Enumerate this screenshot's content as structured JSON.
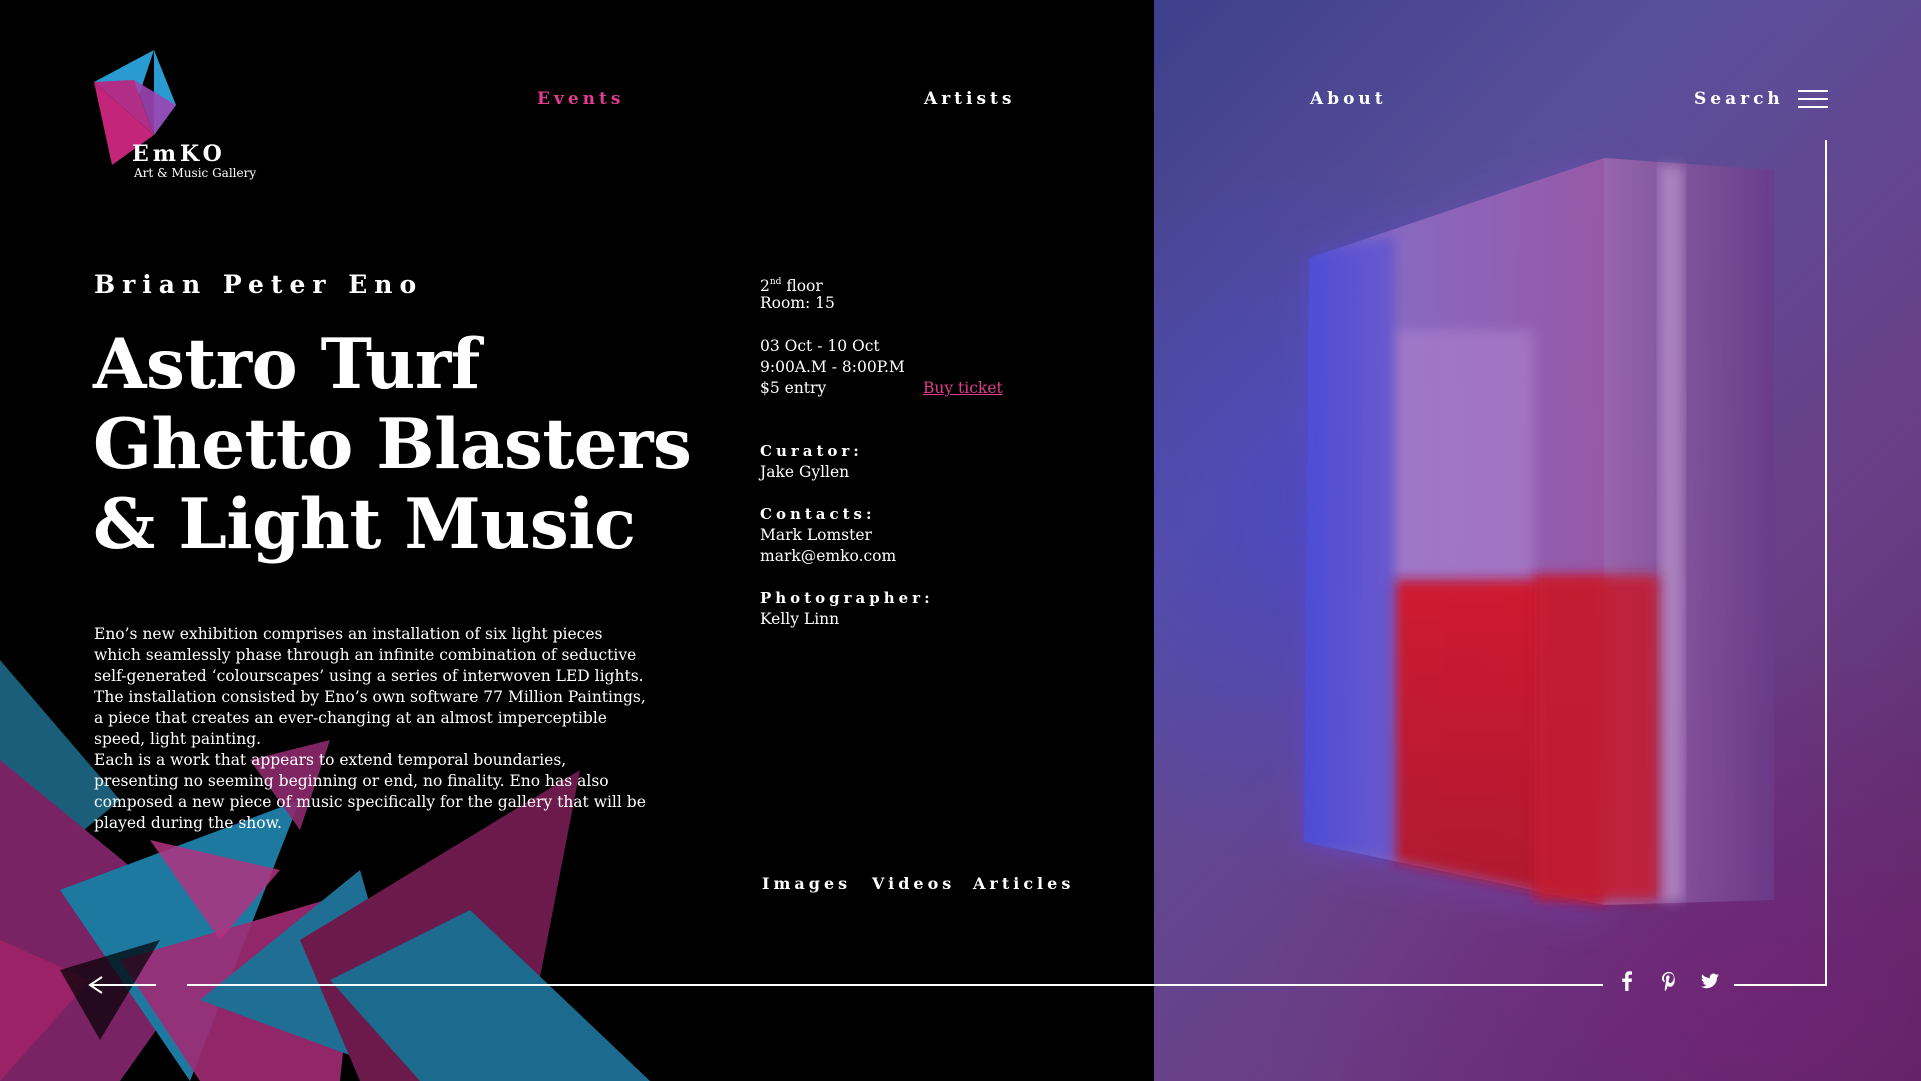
{
  "brand": {
    "name": "EmKO",
    "subtitle": "Art & Music Gallery"
  },
  "nav": {
    "events": "Events",
    "artists": "Artists",
    "about": "About",
    "search": "Search",
    "active": "events"
  },
  "exhibition": {
    "artist": "Brian Peter Eno",
    "title_lines": [
      "Astro Turf",
      "Ghetto Blasters",
      "& Light Music"
    ],
    "paragraphs": [
      "Eno’s new exhibition comprises an installation of six light pieces which seamlessly phase through an infinite combination of seductive self-generated ‘colourscapes’ using a series of interwoven LED lights. The installation consisted by Eno’s own software 77 Million Paintings, a piece that creates an ever-changing at an almost imperceptible speed, light painting.",
      "Each is a work that appears to extend temporal boundaries, presenting no seeming beginning or end, no finality. Eno has also composed a new piece of music specifically for the gallery that will be played during the show."
    ]
  },
  "info": {
    "floor_num": "2",
    "floor_sup": "nd",
    "floor_word": " floor",
    "room": "Room:  15",
    "dates": "03 Oct - 10 Oct",
    "hours": "9:00A.M - 8:00P.M",
    "entry": "$5 entry",
    "buy_ticket": "Buy ticket",
    "curator_label": "Curator:",
    "curator": "Jake Gyllen",
    "contacts_label": "Contacts:",
    "contact_name": "Mark Lomster",
    "contact_email": "mark@emko.com",
    "photographer_label": "Photographer:",
    "photographer": "Kelly Linn"
  },
  "media_tabs": [
    "Images",
    "Videos",
    "Articles"
  ],
  "social": [
    "facebook-icon",
    "pinterest-icon",
    "twitter-icon"
  ],
  "colors": {
    "accent": "#e23c92",
    "background": "#000000",
    "teal": "#2a9bd1",
    "magenta": "#c2257a"
  }
}
